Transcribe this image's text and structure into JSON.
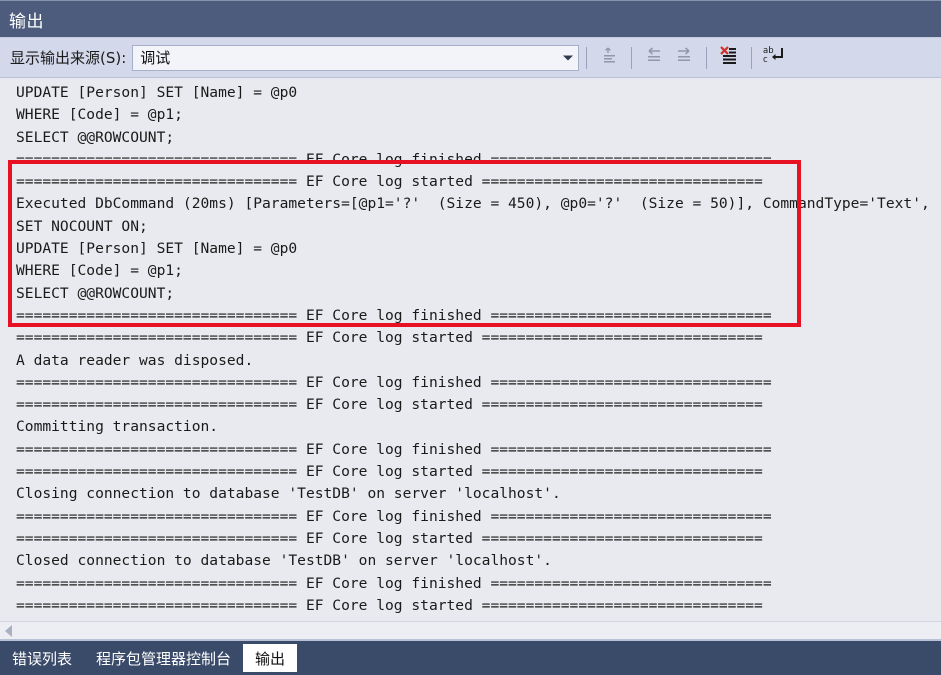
{
  "window": {
    "title": "输出"
  },
  "toolbar": {
    "source_label": "显示输出来源(S):",
    "source_value": "调试",
    "icons": [
      {
        "name": "go-to-message-source-icon",
        "tooltip": "转到消息源"
      },
      {
        "name": "find-previous-message-icon",
        "tooltip": "查找上一条消息"
      },
      {
        "name": "find-next-message-icon",
        "tooltip": "查找下一条消息"
      },
      {
        "name": "clear-all-icon",
        "tooltip": "全部清除"
      },
      {
        "name": "word-wrap-icon",
        "tooltip": "自动换行"
      }
    ]
  },
  "output": {
    "lines": [
      "UPDATE [Person] SET [Name] = @p0",
      "WHERE [Code] = @p1;",
      "SELECT @@ROWCOUNT;",
      "================================ EF Core log finished ================================",
      "================================ EF Core log started ================================",
      "Executed DbCommand (20ms) [Parameters=[@p1='?'  (Size = 450), @p0='?'  (Size = 50)], CommandType='Text',",
      "SET NOCOUNT ON;",
      "UPDATE [Person] SET [Name] = @p0",
      "WHERE [Code] = @p1;",
      "SELECT @@ROWCOUNT;",
      "================================ EF Core log finished ================================",
      "================================ EF Core log started ================================",
      "A data reader was disposed.",
      "================================ EF Core log finished ================================",
      "================================ EF Core log started ================================",
      "Committing transaction.",
      "================================ EF Core log finished ================================",
      "================================ EF Core log started ================================",
      "Closing connection to database 'TestDB' on server 'localhost'.",
      "================================ EF Core log finished ================================",
      "================================ EF Core log started ================================",
      "Closed connection to database 'TestDB' on server 'localhost'.",
      "================================ EF Core log finished ================================",
      "================================ EF Core log started ================================"
    ]
  },
  "annotation": {
    "type": "red-rectangle",
    "color": "#e81123",
    "highlights_lines": [
      "================================ EF Core log started ================================",
      "Executed DbCommand (20ms) [Parameters=[@p1='?'  (Size = 450), @p0='?'  (Size = 50)], CommandType='Text',",
      "SET NOCOUNT ON;",
      "UPDATE [Person] SET [Name] = @p0",
      "WHERE [Code] = @p1;",
      "SELECT @@ROWCOUNT;",
      "================================ EF Core log finished ================================"
    ]
  },
  "tabs": [
    {
      "label": "错误列表",
      "active": false
    },
    {
      "label": "程序包管理器控制台",
      "active": false
    },
    {
      "label": "输出",
      "active": true
    }
  ],
  "colors": {
    "titlebar": "#4d5c7c",
    "toolbar": "#d3d9ea",
    "output_bg": "#e9eaef",
    "tabstrip": "#3a4a69",
    "annotation": "#e81123"
  }
}
